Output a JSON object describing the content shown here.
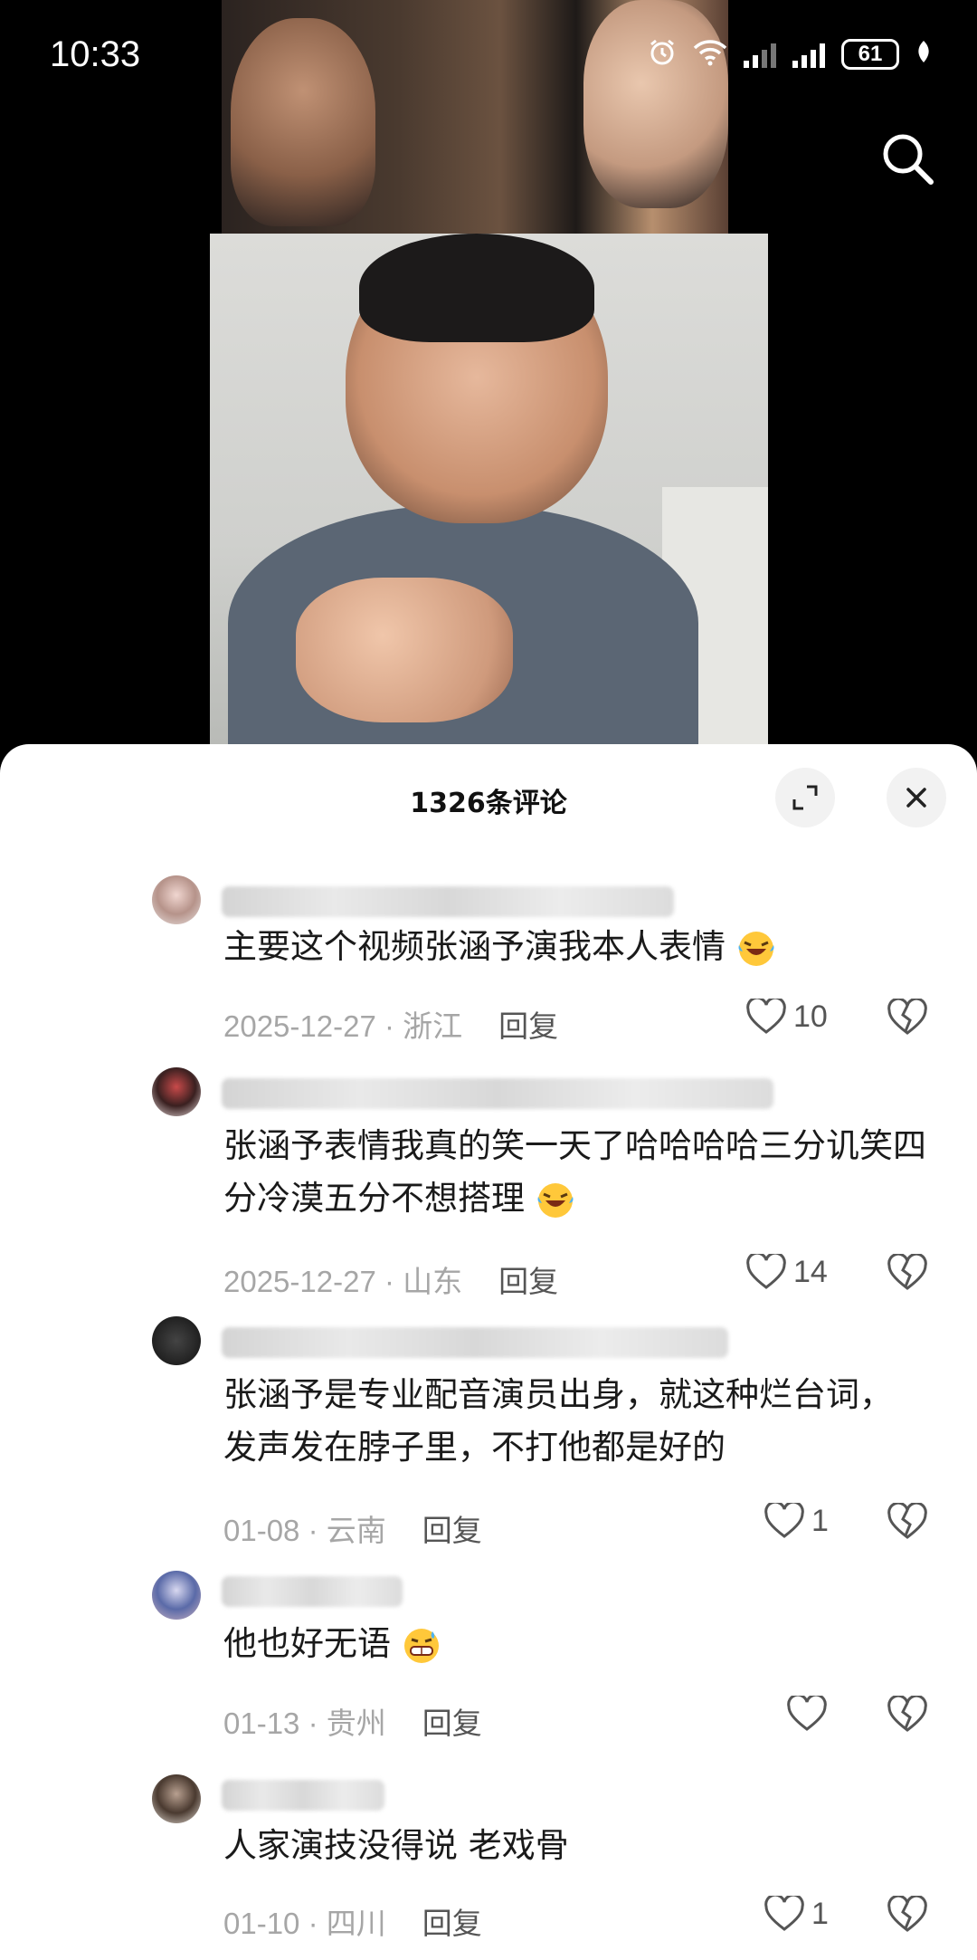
{
  "status_bar": {
    "time": "10:33",
    "battery": "61"
  },
  "comments_panel": {
    "title": "1326条评论",
    "comments": [
      {
        "text": "主要这个视频张涵予演我本人表情",
        "emoji": "laughing-crying",
        "date": "2025-12-27",
        "location": "浙江",
        "reply": "回复",
        "likes": "10"
      },
      {
        "text": "张涵予表情我真的笑一天了哈哈哈哈三分讥笑四分冷漠五分不想搭理",
        "emoji": "laughing-crying",
        "date": "2025-12-27",
        "location": "山东",
        "reply": "回复",
        "likes": "14"
      },
      {
        "text": "张涵予是专业配音演员出身，就这种烂台词，发声发在脖子里，不打他都是好的",
        "date": "01-08",
        "location": "云南",
        "reply": "回复",
        "likes": "1"
      },
      {
        "text": "他也好无语",
        "emoji": "grin-sweat",
        "date": "01-13",
        "location": "贵州",
        "reply": "回复",
        "likes": ""
      },
      {
        "text": "人家演技没得说 老戏骨",
        "date": "01-10",
        "location": "四川",
        "reply": "回复",
        "likes": "1"
      }
    ]
  },
  "icons": [
    "alarm-icon",
    "wifi-icon",
    "signal-icon",
    "battery-icon",
    "search-icon",
    "expand-icon",
    "close-icon",
    "heart-icon",
    "broken-heart-icon"
  ],
  "colors": {
    "sheet_bg": "#ffffff",
    "meta_gray": "#a6a6a6",
    "text": "#1a1a1a"
  }
}
